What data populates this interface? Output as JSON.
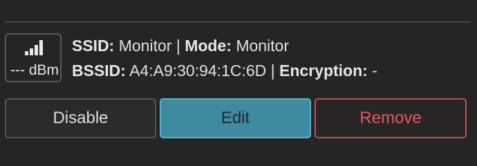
{
  "signal": {
    "icon": "signal-strength-icon",
    "value": "--- dBm"
  },
  "info": {
    "ssid_label": "SSID:",
    "ssid_value": "Monitor",
    "sep1": "|",
    "mode_label": "Mode:",
    "mode_value": "Monitor",
    "bssid_label": "BSSID:",
    "bssid_value": "A4:A9:30:94:1C:6D",
    "sep2": "|",
    "encryption_label": "Encryption:",
    "encryption_value": "-"
  },
  "buttons": {
    "disable": "Disable",
    "edit": "Edit",
    "remove": "Remove"
  },
  "colors": {
    "background": "#252525",
    "edit_accent": "#3e8aa1",
    "remove_accent": "#c05050"
  }
}
